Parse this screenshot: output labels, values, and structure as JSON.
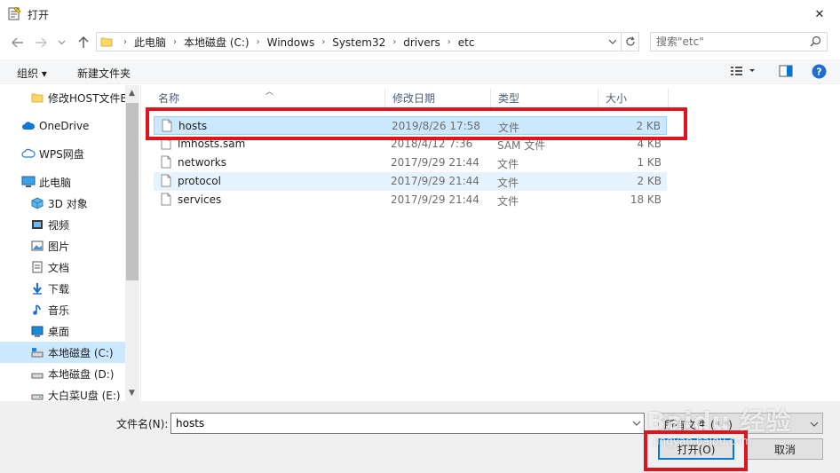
{
  "window": {
    "title": "打开",
    "close_glyph": "✕"
  },
  "address": {
    "crumbs": [
      "此电脑",
      "本地磁盘 (C:)",
      "Windows",
      "System32",
      "drivers",
      "etc"
    ]
  },
  "search": {
    "placeholder": "搜索\"etc\""
  },
  "toolbar": {
    "organize": "组织 ▾",
    "new_folder": "新建文件夹"
  },
  "nav": {
    "items": [
      {
        "label": "修改HOST文件B",
        "icon": "folder-icon"
      },
      {
        "label": "OneDrive",
        "icon": "cloud-icon"
      },
      {
        "label": "WPS网盘",
        "icon": "wps-cloud-icon"
      },
      {
        "label": "此电脑",
        "icon": "computer-icon"
      },
      {
        "label": "3D 对象",
        "icon": "3d-objects-icon"
      },
      {
        "label": "视频",
        "icon": "video-icon"
      },
      {
        "label": "图片",
        "icon": "pictures-icon"
      },
      {
        "label": "文档",
        "icon": "documents-icon"
      },
      {
        "label": "下载",
        "icon": "download-icon"
      },
      {
        "label": "音乐",
        "icon": "music-icon"
      },
      {
        "label": "桌面",
        "icon": "desktop-icon"
      },
      {
        "label": "本地磁盘 (C:)",
        "icon": "drive-icon"
      },
      {
        "label": "本地磁盘 (D:)",
        "icon": "drive-icon"
      },
      {
        "label": "大白菜U盘 (E:)",
        "icon": "usb-drive-icon"
      }
    ]
  },
  "columns": {
    "name": "名称",
    "date": "修改日期",
    "type": "类型",
    "size": "大小"
  },
  "files": [
    {
      "name": "hosts",
      "date": "2019/8/26 17:58",
      "type": "文件",
      "size": "2 KB"
    },
    {
      "name": "lmhosts.sam",
      "date": "2018/4/12 7:36",
      "type": "SAM 文件",
      "size": "4 KB"
    },
    {
      "name": "networks",
      "date": "2017/9/29 21:44",
      "type": "文件",
      "size": "1 KB"
    },
    {
      "name": "protocol",
      "date": "2017/9/29 21:44",
      "type": "文件",
      "size": "2 KB"
    },
    {
      "name": "services",
      "date": "2017/9/29 21:44",
      "type": "文件",
      "size": "18 KB"
    }
  ],
  "bottom": {
    "filename_label": "文件名(N):",
    "filename_value": "hosts",
    "filter_value": "所有文件 (*.*)",
    "open_label": "打开(O)",
    "cancel_label": "取消"
  },
  "colors": {
    "highlight": "#e0141e",
    "selection": "#cce8ff",
    "accent": "#0078d7"
  },
  "watermark": {
    "main": "Baidu 经验",
    "sub": "jingyan.baidu.com"
  }
}
